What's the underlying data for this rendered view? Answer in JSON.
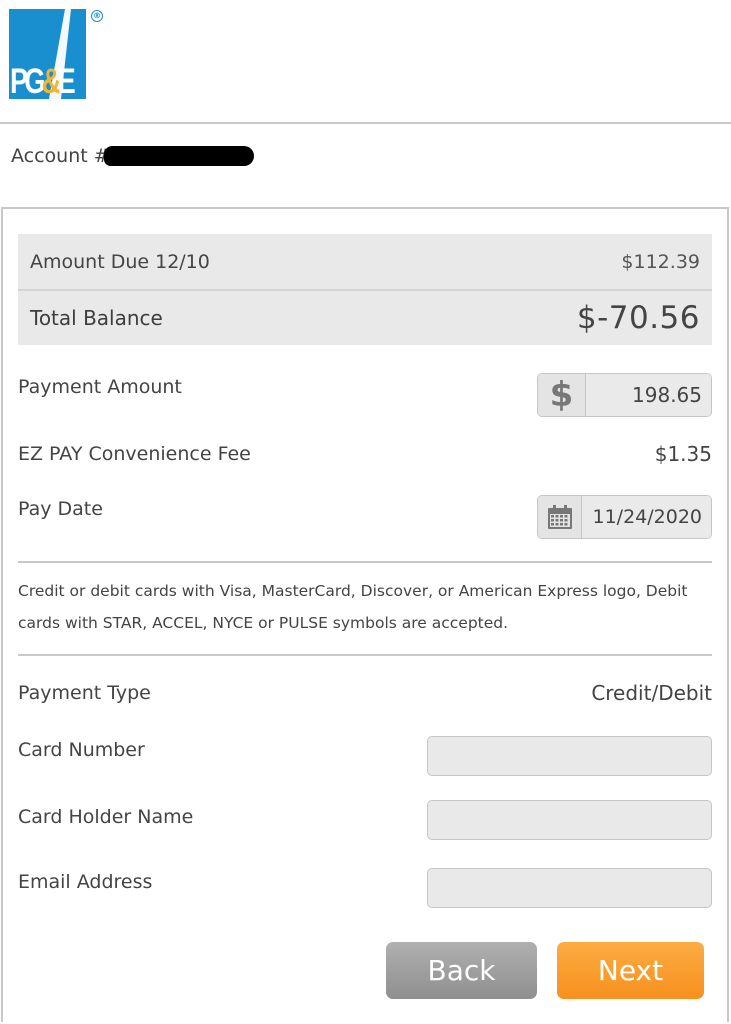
{
  "brand": {
    "logo_text_1": "PG",
    "logo_amp": "&",
    "logo_text_2": "E",
    "registered": "®",
    "color_blue": "#1a8fd0",
    "color_gold": "#f6b330"
  },
  "account": {
    "label": "Account #"
  },
  "summary": {
    "amount_due_label": "Amount Due 12/10",
    "amount_due_value": "$112.39",
    "total_balance_label": "Total Balance",
    "total_balance_value": "$-70.56"
  },
  "payment": {
    "amount_label": "Payment Amount",
    "currency_symbol": "$",
    "amount_value": "198.65",
    "fee_label": "EZ PAY Convenience Fee",
    "fee_value": "$1.35",
    "date_label": "Pay Date",
    "date_icon": "calendar-icon",
    "date_value": "11/24/2020"
  },
  "notice": "Credit or debit cards with Visa, MasterCard, Discover, or American Express logo, Debit cards with STAR, ACCEL, NYCE or PULSE symbols are accepted.",
  "form": {
    "payment_type_label": "Payment Type",
    "payment_type_value": "Credit/Debit",
    "card_number_label": "Card Number",
    "card_holder_label": "Card Holder Name",
    "email_label": "Email Address"
  },
  "buttons": {
    "back": "Back",
    "next": "Next",
    "back_color": "#9e9e9e",
    "next_color": "#f7981f"
  }
}
